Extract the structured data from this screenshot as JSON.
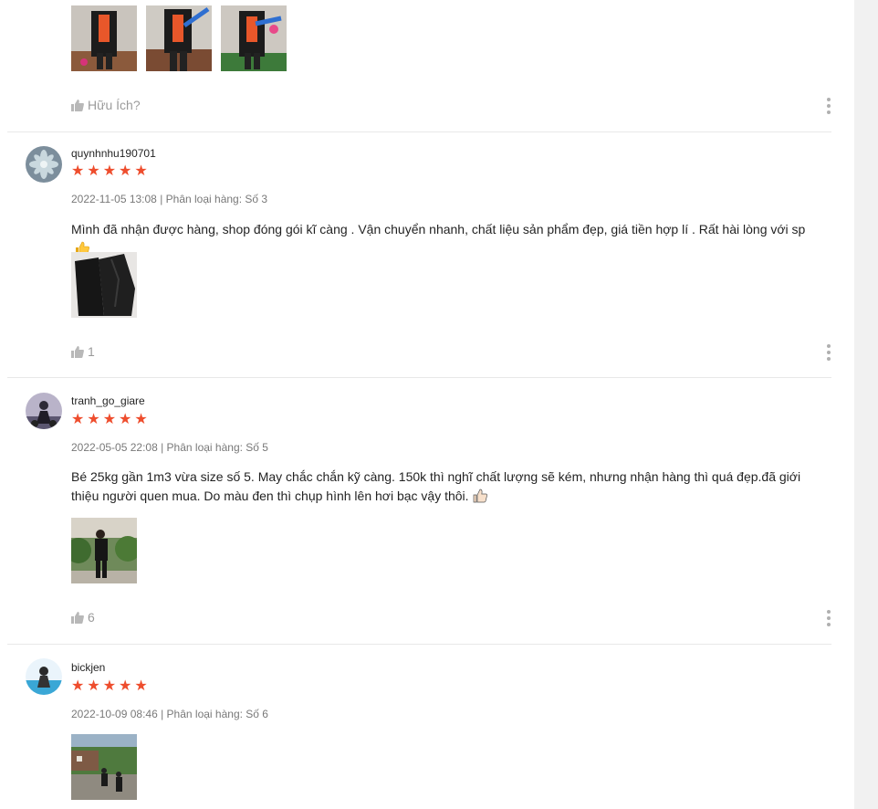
{
  "top_review": {
    "helpful_label": "Hữu Ích?"
  },
  "reviews": [
    {
      "username": "quynhnhu190701",
      "rating": 5,
      "date": "2022-11-05 13:08",
      "separator": " | ",
      "variation": "Phân loại hàng: Số 3",
      "comment": "Mình đã nhận được hàng, shop đóng gói kĩ càng . Vận chuyển nhanh, chất liệu sản phẩm đẹp, giá tiền hợp lí . Rất hài lòng với sp",
      "likes": "1"
    },
    {
      "username": "tranh_go_giare",
      "rating": 5,
      "date": "2022-05-05 22:08",
      "separator": " | ",
      "variation": "Phân loại hàng: Số 5",
      "comment": "Bé 25kg gần 1m3 vừa size số 5.  May chắc chắn kỹ càng. 150k thì nghĩ chất lượng sẽ kém, nhưng nhận hàng thì quá đẹp.đã giới thiệu người quen mua. Do màu đen thì chụp hình lên hơi bạc vậy thôi.",
      "likes": "6"
    },
    {
      "username": "bickjen",
      "rating": 5,
      "date": "2022-10-09 08:46",
      "separator": " | ",
      "variation": "Phân loại hàng: Số 6"
    }
  ],
  "colors": {
    "star": "#ee4d2d",
    "meta_text": "#8a8a8a",
    "divider": "#e8e8e8"
  },
  "icons": {
    "helpful": "thumbs-up-icon",
    "more": "more-vertical-icon",
    "star": "star-icon",
    "emoji": "thumbs-up-emoji"
  }
}
